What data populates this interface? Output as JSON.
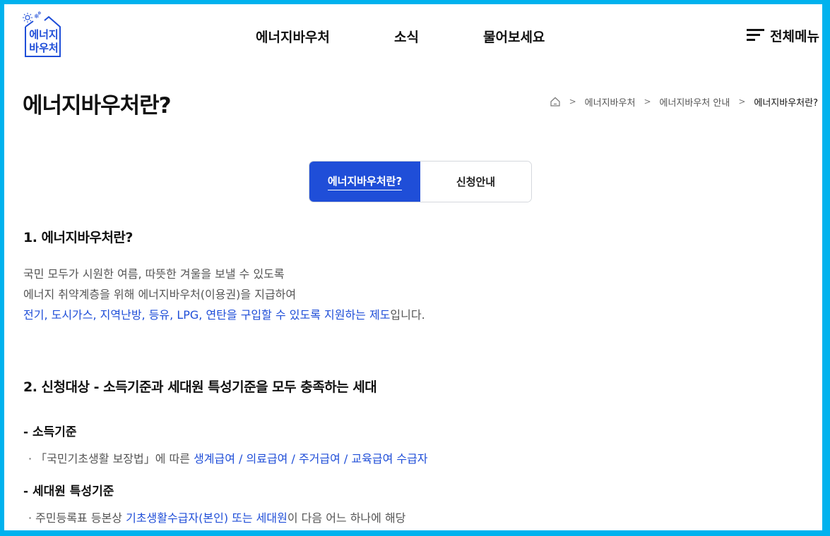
{
  "colors": {
    "frame": "#00b2ee",
    "accent": "#1f4ed8",
    "text": "#111111",
    "muted": "#555555"
  },
  "logo": {
    "line1": "에너지",
    "line2": "바우처",
    "icon": "house-sun-snow-logo"
  },
  "nav": {
    "items": [
      "에너지바우처",
      "소식",
      "물어보세요"
    ],
    "menu_label": "전체메뉴",
    "menu_icon": "hamburger-icon"
  },
  "page": {
    "title": "에너지바우처란?"
  },
  "breadcrumb": {
    "home_icon": "home-icon",
    "items": [
      "에너지바우처",
      "에너지바우처 안내",
      "에너지바우처란?"
    ]
  },
  "tabs": [
    {
      "label": "에너지바우처란?",
      "active": true
    },
    {
      "label": "신청안내",
      "active": false
    }
  ],
  "section1": {
    "heading": "1. 에너지바우처란?",
    "line1": "국민 모두가 시원한 여름, 따뜻한 겨울을 보낼 수 있도록",
    "line2": "에너지 취약계층을 위해 에너지바우처(이용권)을 지급하여",
    "line3_highlight": "전기, 도시가스, 지역난방, 등유, LPG, 연탄을 구입할 수 있도록 지원하는 제도",
    "line3_rest": "입니다."
  },
  "section2": {
    "heading": "2. 신청대상 - 소득기준과 세대원 특성기준을 모두 충족하는 세대",
    "income": {
      "title": "- 소득기준",
      "prefix": "· 「국민기초생활 보장법」에 따른 ",
      "highlight": "생계급여 / 의료급여 / 주거급여 / 교육급여 수급자"
    },
    "household": {
      "title": "- 세대원 특성기준",
      "prefix": "· 주민등록표 등본상 ",
      "highlight": "기초생활수급자(본인) 또는 세대원",
      "suffix": "이 다음 어느 하나에 해당"
    }
  }
}
